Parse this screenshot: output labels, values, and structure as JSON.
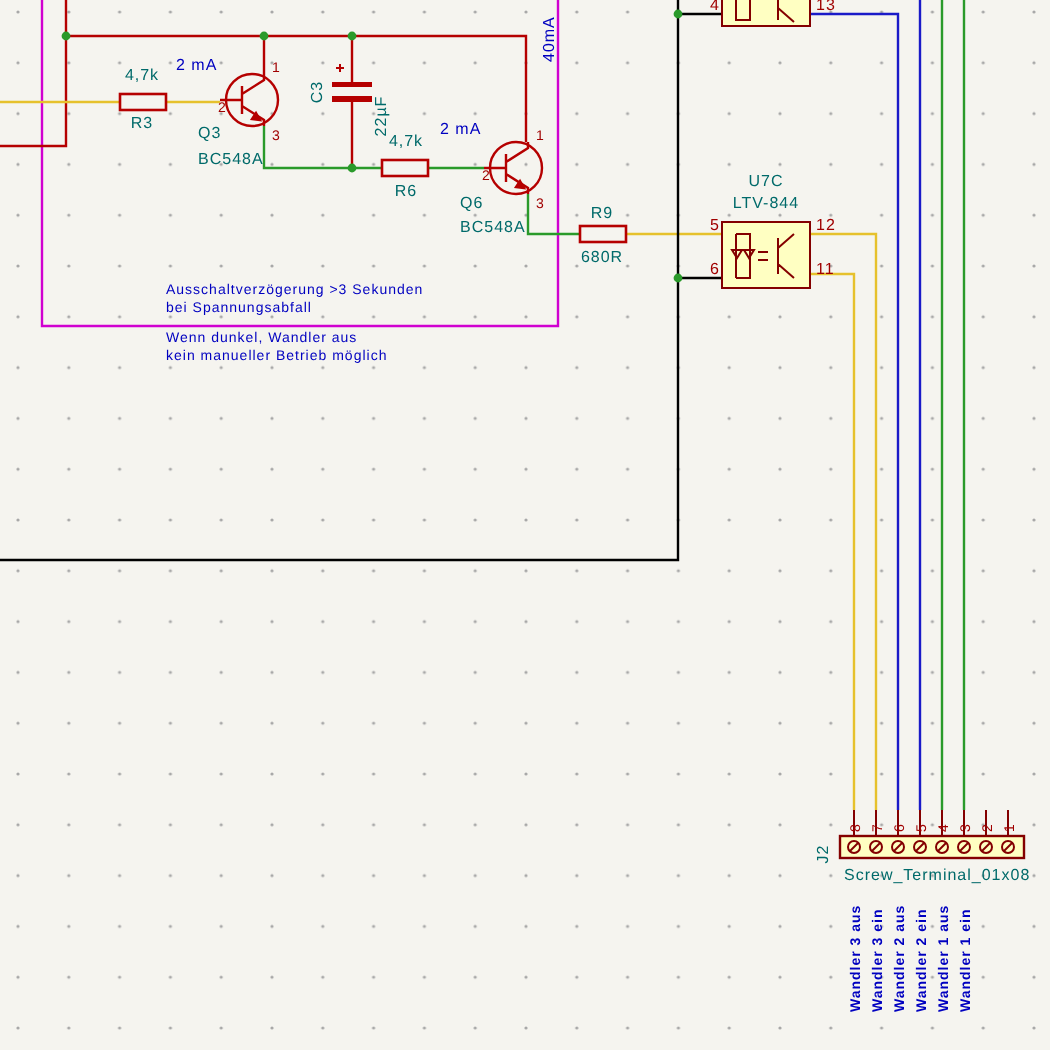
{
  "schematic": {
    "components": [
      {
        "kind": "resistor",
        "reference": "R3",
        "value": "4,7k"
      },
      {
        "kind": "transistor",
        "reference": "Q3",
        "value": "BC548A",
        "pins": [
          "1",
          "2",
          "3"
        ]
      },
      {
        "kind": "capacitor",
        "reference": "C3",
        "value": "22µF"
      },
      {
        "kind": "resistor",
        "reference": "R6",
        "value": "4,7k"
      },
      {
        "kind": "transistor",
        "reference": "Q6",
        "value": "BC548A",
        "pins": [
          "1",
          "2",
          "3"
        ]
      },
      {
        "kind": "resistor",
        "reference": "R9",
        "value": "680R"
      },
      {
        "kind": "optocoupler",
        "pins": [
          "4",
          "13"
        ]
      },
      {
        "kind": "optocoupler",
        "reference": "U7C",
        "value": "LTV-844",
        "pins": [
          "5",
          "6",
          "12",
          "11"
        ]
      },
      {
        "kind": "connector",
        "reference": "J2",
        "value": "Screw_Terminal_01x08",
        "pins": [
          "8",
          "7",
          "6",
          "5",
          "4",
          "3",
          "2",
          "1"
        ]
      }
    ],
    "current_labels": [
      "2 mA",
      "2 mA",
      "40mA"
    ],
    "notes": [
      "Ausschaltverzögerung >3 Sekunden",
      "bei Spannungsabfall",
      "Wenn dunkel, Wandler aus",
      "kein manueller Betrieb möglich"
    ],
    "net_labels": [
      "Wandler 3 aus",
      "Wandler 3 ein",
      "Wandler 2 aus",
      "Wandler 2 ein",
      "Wandler 1 aus",
      "Wandler 1 ein"
    ]
  }
}
